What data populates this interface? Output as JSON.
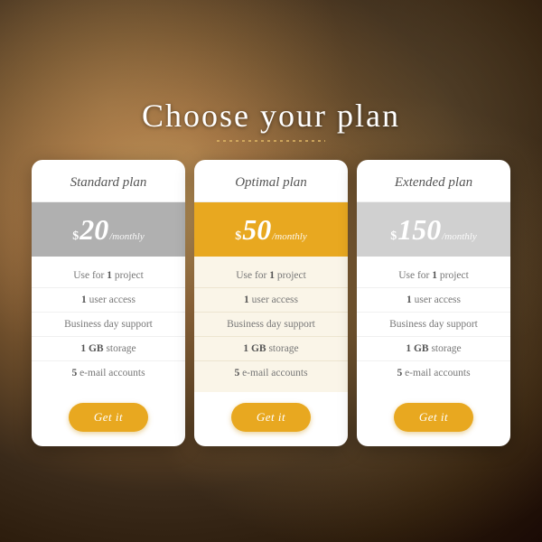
{
  "page": {
    "title": "Choose your plan",
    "dots_decoration": "· · · · · · · · · · · · · · · · · · · · · · · · · ·"
  },
  "plans": [
    {
      "id": "standard",
      "name": "Standard plan",
      "price_symbol": "$",
      "price_amount": "20",
      "price_period": "/monthly",
      "price_style": "standard",
      "features": [
        "Use for 1 project",
        "1 user access",
        "Business day support",
        "1 GB storage",
        "5 e-mail accounts"
      ],
      "features_bold": [
        "1",
        "1",
        "",
        "1 GB",
        "5"
      ],
      "button_label": "Get it"
    },
    {
      "id": "optimal",
      "name": "Optimal plan",
      "price_symbol": "$",
      "price_amount": "50",
      "price_period": "/monthly",
      "price_style": "optimal",
      "features": [
        "Use for 1 project",
        "1 user access",
        "Business day support",
        "1 GB storage",
        "5 e-mail accounts"
      ],
      "features_bold": [
        "1",
        "1",
        "",
        "1 GB",
        "5"
      ],
      "button_label": "Get it"
    },
    {
      "id": "extended",
      "name": "Extended plan",
      "price_symbol": "$",
      "price_amount": "150",
      "price_period": "/monthly",
      "price_style": "extended",
      "features": [
        "Use for 1 project",
        "1 user access",
        "Business day support",
        "1 GB storage",
        "5 e-mail accounts"
      ],
      "features_bold": [
        "1",
        "1",
        "",
        "1 GB",
        "5"
      ],
      "button_label": "Get it"
    }
  ],
  "colors": {
    "gold": "#e8a820",
    "gray": "#b0b0b0",
    "light_gray": "#d0d0d0"
  }
}
